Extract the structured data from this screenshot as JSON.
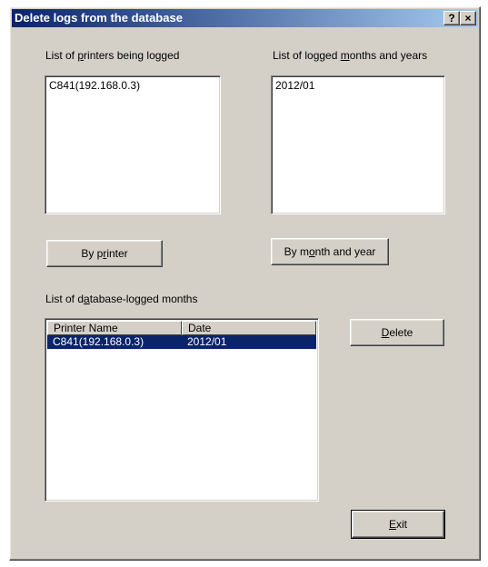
{
  "window": {
    "title": "Delete logs from the database",
    "help_label": "?",
    "close_label": "×"
  },
  "printers": {
    "label_pre": "List of ",
    "label_u": "p",
    "label_post": "rinters being logged",
    "items": [
      "C841(192.168.0.3)"
    ]
  },
  "months": {
    "label_pre": "List of logged ",
    "label_u": "m",
    "label_post": "onths and years",
    "items": [
      "2012/01"
    ]
  },
  "buttons": {
    "by_printer_pre": "By p",
    "by_printer_u": "r",
    "by_printer_post": "inter",
    "by_month_pre": "By m",
    "by_month_u": "o",
    "by_month_post": "nth and year",
    "delete_u": "D",
    "delete_post": "elete",
    "exit_u": "E",
    "exit_post": "xit"
  },
  "db_months": {
    "label_pre": "List of d",
    "label_u": "a",
    "label_post": "tabase-logged months",
    "columns": [
      "Printer Name",
      "Date"
    ],
    "rows": [
      {
        "printer": "C841(192.168.0.3)",
        "date": "2012/01"
      }
    ]
  }
}
